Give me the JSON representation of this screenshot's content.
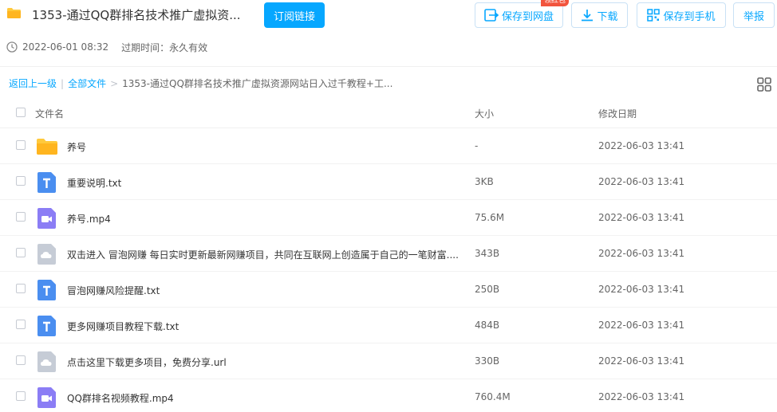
{
  "header": {
    "title": "1353-通过QQ群排名技术推广虚拟资...",
    "subscribe_label": "订阅链接",
    "save_cloud_label": "保存到网盘",
    "badge_label": "领红包",
    "download_label": "下载",
    "save_phone_label": "保存到手机",
    "report_label": "举报"
  },
  "meta": {
    "created": "2022-06-01 08:32",
    "expire": "过期时间：永久有效"
  },
  "breadcrumb": {
    "back": "返回上一级",
    "separator": "|",
    "root": "全部文件",
    "arrow": ">",
    "current": "1353-通过QQ群排名技术推广虚拟资源网站日入过千教程+工..."
  },
  "table": {
    "headers": {
      "name": "文件名",
      "size": "大小",
      "date": "修改日期"
    },
    "rows": [
      {
        "icon": "folder-icon",
        "name": "养号",
        "size": "-",
        "date": "2022-06-03 13:41"
      },
      {
        "icon": "text-file-icon",
        "name": "重要说明.txt",
        "size": "3KB",
        "date": "2022-06-03 13:41"
      },
      {
        "icon": "video-file-icon",
        "name": "养号.mp4",
        "size": "75.6M",
        "date": "2022-06-03 13:41"
      },
      {
        "icon": "cloud-file-icon",
        "name": "双击进入 冒泡网赚 每日实时更新最新网赚项目，共同在互联网上创造属于自己的一笔财富....",
        "size": "343B",
        "date": "2022-06-03 13:41"
      },
      {
        "icon": "text-file-icon",
        "name": "冒泡网赚风险提醒.txt",
        "size": "250B",
        "date": "2022-06-03 13:41"
      },
      {
        "icon": "text-file-icon",
        "name": "更多网赚项目教程下载.txt",
        "size": "484B",
        "date": "2022-06-03 13:41"
      },
      {
        "icon": "cloud-file-icon",
        "name": "点击这里下载更多项目，免费分享.url",
        "size": "330B",
        "date": "2022-06-03 13:41"
      },
      {
        "icon": "video-file-icon",
        "name": "QQ群排名视频教程.mp4",
        "size": "760.4M",
        "date": "2022-06-03 13:41"
      }
    ]
  },
  "colors": {
    "accent": "#06a7ff",
    "folder": "#ffc93c",
    "text_file": "#4a8ef0",
    "video_file": "#8b7df5",
    "cloud_file": "#c6ccd6",
    "badge": "#f2543d"
  }
}
